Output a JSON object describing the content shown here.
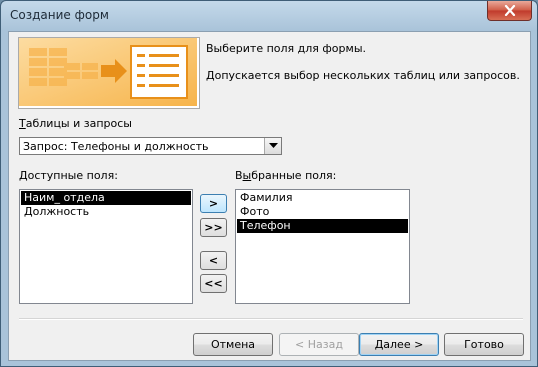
{
  "window": {
    "title": "Создание форм"
  },
  "header": {
    "line1": "Выберите поля для формы.",
    "line2": "Допускается выбор нескольких таблиц или запросов."
  },
  "tables": {
    "label_accel": "Т",
    "label_rest": "аблицы и запросы",
    "selected": "Запрос: Телефоны и должность"
  },
  "available": {
    "label_accel": "Д",
    "label_rest": "оступные поля:",
    "items": [
      "Наим_ отдела",
      "Должность"
    ]
  },
  "selected_fields": {
    "label_pre": "В",
    "label_accel": "ы",
    "label_rest": "бранные поля:",
    "items": [
      "Фамилия",
      "Фото",
      "Телефон"
    ]
  },
  "move_buttons": {
    "add": ">",
    "add_all": ">>",
    "remove": "<",
    "remove_all": "<<"
  },
  "footer": {
    "cancel": "Отмена",
    "back": "< Назад",
    "next": "Далее >",
    "finish": "Готово"
  },
  "colors": {
    "accent": "#f4a020",
    "selection": "#000000"
  }
}
